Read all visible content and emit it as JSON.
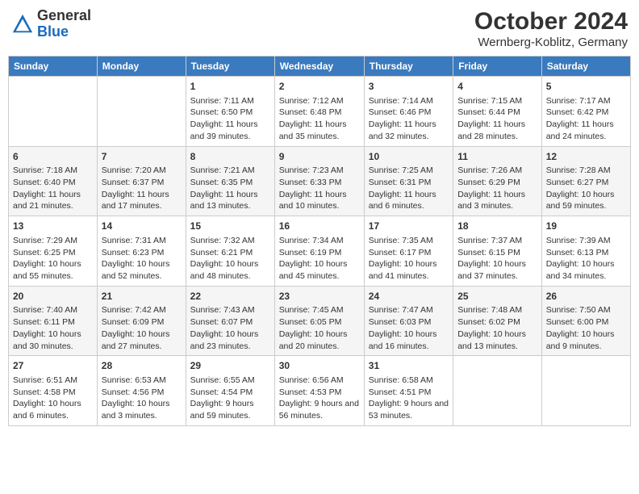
{
  "header": {
    "logo_general": "General",
    "logo_blue": "Blue",
    "month": "October 2024",
    "location": "Wernberg-Koblitz, Germany"
  },
  "days_of_week": [
    "Sunday",
    "Monday",
    "Tuesday",
    "Wednesday",
    "Thursday",
    "Friday",
    "Saturday"
  ],
  "weeks": [
    [
      {
        "day": "",
        "info": ""
      },
      {
        "day": "",
        "info": ""
      },
      {
        "day": "1",
        "info": "Sunrise: 7:11 AM\nSunset: 6:50 PM\nDaylight: 11 hours and 39 minutes."
      },
      {
        "day": "2",
        "info": "Sunrise: 7:12 AM\nSunset: 6:48 PM\nDaylight: 11 hours and 35 minutes."
      },
      {
        "day": "3",
        "info": "Sunrise: 7:14 AM\nSunset: 6:46 PM\nDaylight: 11 hours and 32 minutes."
      },
      {
        "day": "4",
        "info": "Sunrise: 7:15 AM\nSunset: 6:44 PM\nDaylight: 11 hours and 28 minutes."
      },
      {
        "day": "5",
        "info": "Sunrise: 7:17 AM\nSunset: 6:42 PM\nDaylight: 11 hours and 24 minutes."
      }
    ],
    [
      {
        "day": "6",
        "info": "Sunrise: 7:18 AM\nSunset: 6:40 PM\nDaylight: 11 hours and 21 minutes."
      },
      {
        "day": "7",
        "info": "Sunrise: 7:20 AM\nSunset: 6:37 PM\nDaylight: 11 hours and 17 minutes."
      },
      {
        "day": "8",
        "info": "Sunrise: 7:21 AM\nSunset: 6:35 PM\nDaylight: 11 hours and 13 minutes."
      },
      {
        "day": "9",
        "info": "Sunrise: 7:23 AM\nSunset: 6:33 PM\nDaylight: 11 hours and 10 minutes."
      },
      {
        "day": "10",
        "info": "Sunrise: 7:25 AM\nSunset: 6:31 PM\nDaylight: 11 hours and 6 minutes."
      },
      {
        "day": "11",
        "info": "Sunrise: 7:26 AM\nSunset: 6:29 PM\nDaylight: 11 hours and 3 minutes."
      },
      {
        "day": "12",
        "info": "Sunrise: 7:28 AM\nSunset: 6:27 PM\nDaylight: 10 hours and 59 minutes."
      }
    ],
    [
      {
        "day": "13",
        "info": "Sunrise: 7:29 AM\nSunset: 6:25 PM\nDaylight: 10 hours and 55 minutes."
      },
      {
        "day": "14",
        "info": "Sunrise: 7:31 AM\nSunset: 6:23 PM\nDaylight: 10 hours and 52 minutes."
      },
      {
        "day": "15",
        "info": "Sunrise: 7:32 AM\nSunset: 6:21 PM\nDaylight: 10 hours and 48 minutes."
      },
      {
        "day": "16",
        "info": "Sunrise: 7:34 AM\nSunset: 6:19 PM\nDaylight: 10 hours and 45 minutes."
      },
      {
        "day": "17",
        "info": "Sunrise: 7:35 AM\nSunset: 6:17 PM\nDaylight: 10 hours and 41 minutes."
      },
      {
        "day": "18",
        "info": "Sunrise: 7:37 AM\nSunset: 6:15 PM\nDaylight: 10 hours and 37 minutes."
      },
      {
        "day": "19",
        "info": "Sunrise: 7:39 AM\nSunset: 6:13 PM\nDaylight: 10 hours and 34 minutes."
      }
    ],
    [
      {
        "day": "20",
        "info": "Sunrise: 7:40 AM\nSunset: 6:11 PM\nDaylight: 10 hours and 30 minutes."
      },
      {
        "day": "21",
        "info": "Sunrise: 7:42 AM\nSunset: 6:09 PM\nDaylight: 10 hours and 27 minutes."
      },
      {
        "day": "22",
        "info": "Sunrise: 7:43 AM\nSunset: 6:07 PM\nDaylight: 10 hours and 23 minutes."
      },
      {
        "day": "23",
        "info": "Sunrise: 7:45 AM\nSunset: 6:05 PM\nDaylight: 10 hours and 20 minutes."
      },
      {
        "day": "24",
        "info": "Sunrise: 7:47 AM\nSunset: 6:03 PM\nDaylight: 10 hours and 16 minutes."
      },
      {
        "day": "25",
        "info": "Sunrise: 7:48 AM\nSunset: 6:02 PM\nDaylight: 10 hours and 13 minutes."
      },
      {
        "day": "26",
        "info": "Sunrise: 7:50 AM\nSunset: 6:00 PM\nDaylight: 10 hours and 9 minutes."
      }
    ],
    [
      {
        "day": "27",
        "info": "Sunrise: 6:51 AM\nSunset: 4:58 PM\nDaylight: 10 hours and 6 minutes."
      },
      {
        "day": "28",
        "info": "Sunrise: 6:53 AM\nSunset: 4:56 PM\nDaylight: 10 hours and 3 minutes."
      },
      {
        "day": "29",
        "info": "Sunrise: 6:55 AM\nSunset: 4:54 PM\nDaylight: 9 hours and 59 minutes."
      },
      {
        "day": "30",
        "info": "Sunrise: 6:56 AM\nSunset: 4:53 PM\nDaylight: 9 hours and 56 minutes."
      },
      {
        "day": "31",
        "info": "Sunrise: 6:58 AM\nSunset: 4:51 PM\nDaylight: 9 hours and 53 minutes."
      },
      {
        "day": "",
        "info": ""
      },
      {
        "day": "",
        "info": ""
      }
    ]
  ]
}
